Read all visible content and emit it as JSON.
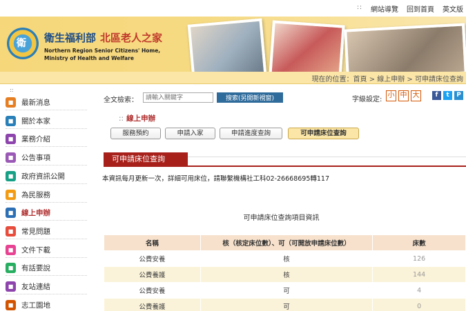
{
  "topbar": {
    "dots": "::",
    "links": [
      "網站導覽",
      "回到首頁",
      "英文版"
    ]
  },
  "header": {
    "logo_text": "衛",
    "title_main": "衛生福利部",
    "title_sub": "北區老人之家",
    "title_en_line1": "Northern Region Senior Citizens' Home,",
    "title_en_line2": "Ministry of Health and Welfare"
  },
  "breadcrumb": {
    "text": "現在的位置：首頁 > 線上申辦 > 可申請床位查詢"
  },
  "sidebar": {
    "dots": "::",
    "items": [
      {
        "label": "最新消息",
        "icon": "news-icon",
        "color": "#e67e22"
      },
      {
        "label": "關於本家",
        "icon": "about-icon",
        "color": "#2980b9"
      },
      {
        "label": "業務介紹",
        "icon": "business-icon",
        "color": "#8e44ad"
      },
      {
        "label": "公告事項",
        "icon": "announcement-icon",
        "color": "#9b59b6"
      },
      {
        "label": "政府資訊公開",
        "icon": "gov-info-icon",
        "color": "#16a085"
      },
      {
        "label": "為民服務",
        "icon": "service-icon",
        "color": "#f39c12"
      },
      {
        "label": "線上申辦",
        "icon": "online-apply-icon",
        "color": "#2c6fb5",
        "active": true
      },
      {
        "label": "常見問題",
        "icon": "faq-icon",
        "color": "#e74c3c"
      },
      {
        "label": "文件下載",
        "icon": "download-icon",
        "color": "#e84393"
      },
      {
        "label": "有話要說",
        "icon": "message-icon",
        "color": "#27ae60"
      },
      {
        "label": "友站連結",
        "icon": "links-icon",
        "color": "#8e44ad"
      },
      {
        "label": "志工園地",
        "icon": "volunteer-icon",
        "color": "#d35400"
      }
    ]
  },
  "search": {
    "label": "全文檢索：",
    "placeholder": "請輸入關鍵字",
    "button": "搜索(另開新視窗)"
  },
  "font_size": {
    "label": "字級設定:",
    "small": "小",
    "medium": "中",
    "large": "大"
  },
  "social": {
    "facebook": "f",
    "twitter": "t",
    "plurk": "P",
    "colors": {
      "facebook": "#3b5998",
      "twitter": "#1da1f2",
      "plurk": "#2a8fd0"
    }
  },
  "section": {
    "dots": "::",
    "title": "線上申辦",
    "tabs": [
      "服務預約",
      "申請入家",
      "申請進度查詢",
      "可申請床位查詢"
    ],
    "active_tab": 3
  },
  "page_tab": "可申請床位查詢",
  "notice": "本資訊每月更新一次，詳細可用床位，請聯繫機構社工科02-26668695轉117",
  "table": {
    "caption": "可申請床位查詢項目資訊",
    "headers": [
      "名稱",
      "核（核定床位數）、可（可開放申請床位數）",
      "床數"
    ],
    "rows": [
      [
        "公費安養",
        "核",
        "126"
      ],
      [
        "公費養護",
        "核",
        "144"
      ],
      [
        "公費安養",
        "可",
        "4"
      ],
      [
        "公費養護",
        "可",
        "0"
      ]
    ]
  },
  "colors": {
    "accent_red": "#a8201a",
    "banner_yellow": "#f6d77a",
    "link_blue": "#2f6b9b"
  }
}
